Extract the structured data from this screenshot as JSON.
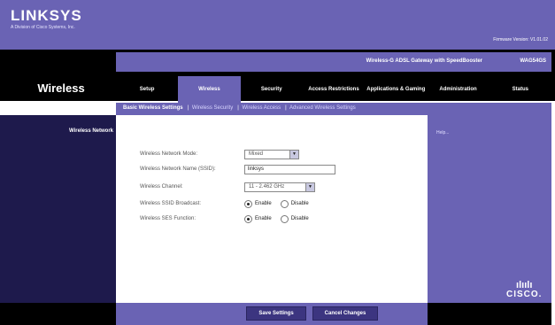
{
  "header": {
    "brand": "LINKSYS",
    "brand_sub": "A Division of Cisco Systems, Inc.",
    "firmware": "Firmware Version: V1.01.02"
  },
  "product": {
    "name": "Wireless-G ADSL Gateway with SpeedBooster",
    "model": "WAG54GS"
  },
  "section": {
    "title": "Wireless"
  },
  "tabs": [
    {
      "label": "Setup"
    },
    {
      "label": "Wireless"
    },
    {
      "label": "Security"
    },
    {
      "label": "Access Restrictions"
    },
    {
      "label": "Applications & Gaming"
    },
    {
      "label": "Administration"
    },
    {
      "label": "Status"
    }
  ],
  "subtabs": [
    {
      "label": "Basic Wireless Settings"
    },
    {
      "label": "Wireless Security"
    },
    {
      "label": "Wireless Access"
    },
    {
      "label": "Advanced Wireless Settings"
    }
  ],
  "left": {
    "heading": "Wireless Network"
  },
  "form": {
    "mode_label": "Wireless Network Mode:",
    "mode_value": "Mixed",
    "ssid_label": "Wireless Network Name (SSID):",
    "ssid_value": "linksys",
    "channel_label": "Wireless Channel:",
    "channel_value": "11 - 2.462 GHz",
    "ssid_broadcast_label": "Wireless SSID Broadcast:",
    "ses_label": "Wireless SES Function:",
    "enable_label": "Enable",
    "disable_label": "Disable"
  },
  "help": {
    "title": "Help..."
  },
  "brand_footer": {
    "bars": "ılıılı",
    "word": "CISCO."
  },
  "buttons": {
    "save": "Save Settings",
    "cancel": "Cancel Changes"
  },
  "colors": {
    "purple": "#6a63b4",
    "navy": "#1e1a4c",
    "black": "#000000"
  }
}
